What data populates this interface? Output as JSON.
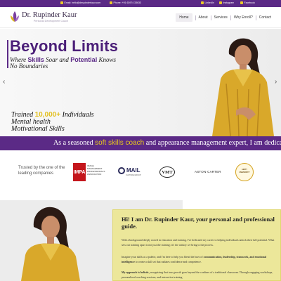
{
  "topbar": {
    "email": "Email: hello@drrupinderkaur.com",
    "phone": "Phone: +91 63974 33633",
    "socials": [
      "LinkedIn",
      "Instagram",
      "Facebook"
    ]
  },
  "header": {
    "logo_name": "Dr. Rupinder Kaur",
    "logo_tagline": "Personal Development Coach",
    "nav": [
      "Home",
      "About",
      "Services",
      "Why Enroll?",
      "Contact"
    ]
  },
  "hero": {
    "title": "Beyond Limits",
    "line1_pre": "Where",
    "line1_b1": "Skills",
    "line1_mid": "Soar and",
    "line1_b2": "Potential",
    "line1_post": "Knows",
    "line2": "No Boundaries",
    "stat1_pre": "Trained",
    "stat1_hl": "10,000+",
    "stat1_post": "Individuals",
    "stat2": "Mental health",
    "stat3": "Motivational Skills",
    "arrow_left": "‹",
    "arrow_right": "›"
  },
  "banner": {
    "pre": "As a seasoned",
    "hl": "soft skills coach",
    "post": "and appearance management expert, I am dedica"
  },
  "trusted": {
    "text": "Trusted by the one of the leading companies",
    "logos": {
      "impa_short": "IMPA",
      "impa_full": "IMAGE MANAGEMENT PROFESSIONALS ASSOCIATION",
      "mail": "MAIL",
      "mail_sub": "CULTURE GROUP",
      "vmt": "VMT",
      "aston": "ASTON·CARTER",
      "amity": "AMITY UNIVERSITY"
    }
  },
  "about": {
    "title": "Hi! I am Dr. Rupinder Kaur, your personal and professional guide.",
    "p1": "With a background deeply rooted in education and training, I've dedicated my career to helping individuals unlock their full potential. What sets our training apart is not just the training; it's the artistry we bring to the process.",
    "p2_pre": "Imagine your skills as a palette, and I'm here to help you blend the hues of",
    "p2_b": "communication, leadership, teamwork, and emotional intelligence",
    "p2_post": "to create a skill set that radiates confidence and competence.",
    "p3_b": "My approach is holistic,",
    "p3_post": "recognizing that true growth goes beyond the confines of a traditional classroom. Through engaging workshops, personalized coaching sessions, and interactive training"
  },
  "colors": {
    "purple": "#5b2a86",
    "gold": "#e8c91e",
    "card_yellow": "#ece79a"
  }
}
